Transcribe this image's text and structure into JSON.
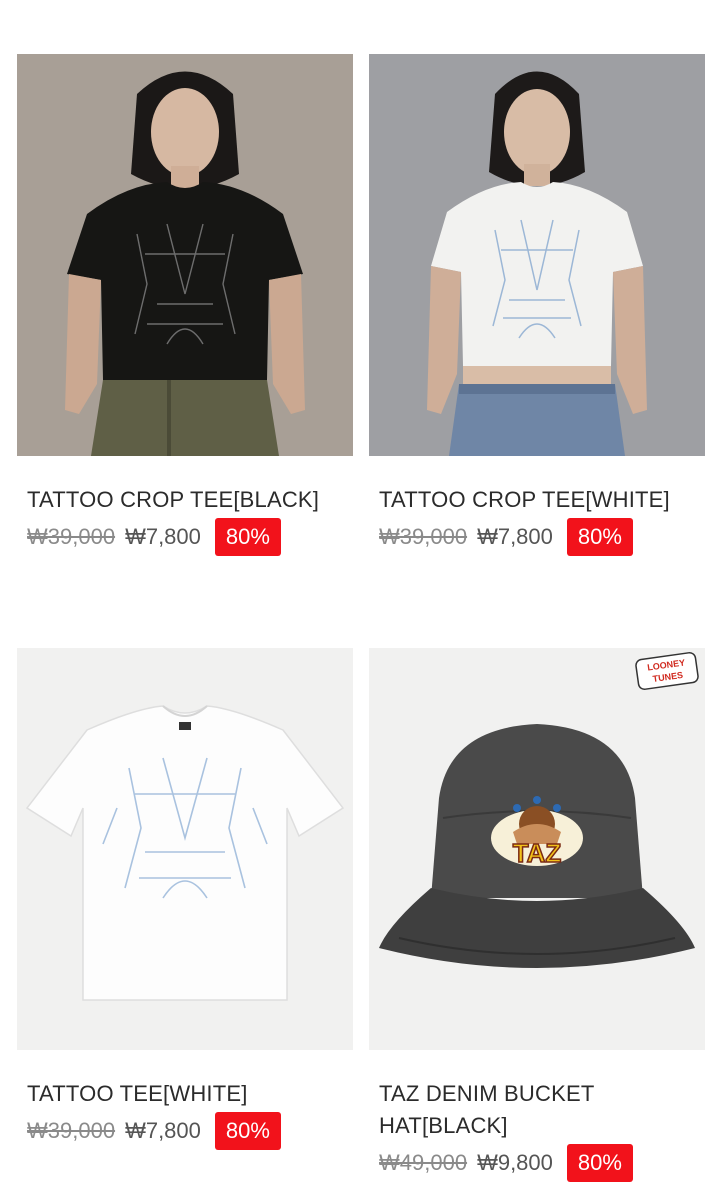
{
  "products": [
    {
      "name": "TATTOO CROP TEE[BLACK]",
      "old_price": "₩39,000",
      "price": "₩7,800",
      "discount": "80%"
    },
    {
      "name": "TATTOO CROP TEE[WHITE]",
      "old_price": "₩39,000",
      "price": "₩7,800",
      "discount": "80%"
    },
    {
      "name": "TATTOO TEE[WHITE]",
      "old_price": "₩39,000",
      "price": "₩7,800",
      "discount": "80%"
    },
    {
      "name": "TAZ DENIM BUCKET HAT[BLACK]",
      "old_price": "₩49,000",
      "price": "₩9,800",
      "discount": "80%"
    }
  ],
  "brand_logo_text": "LOONEY TUNES",
  "hat_patch_text": "TAZ"
}
